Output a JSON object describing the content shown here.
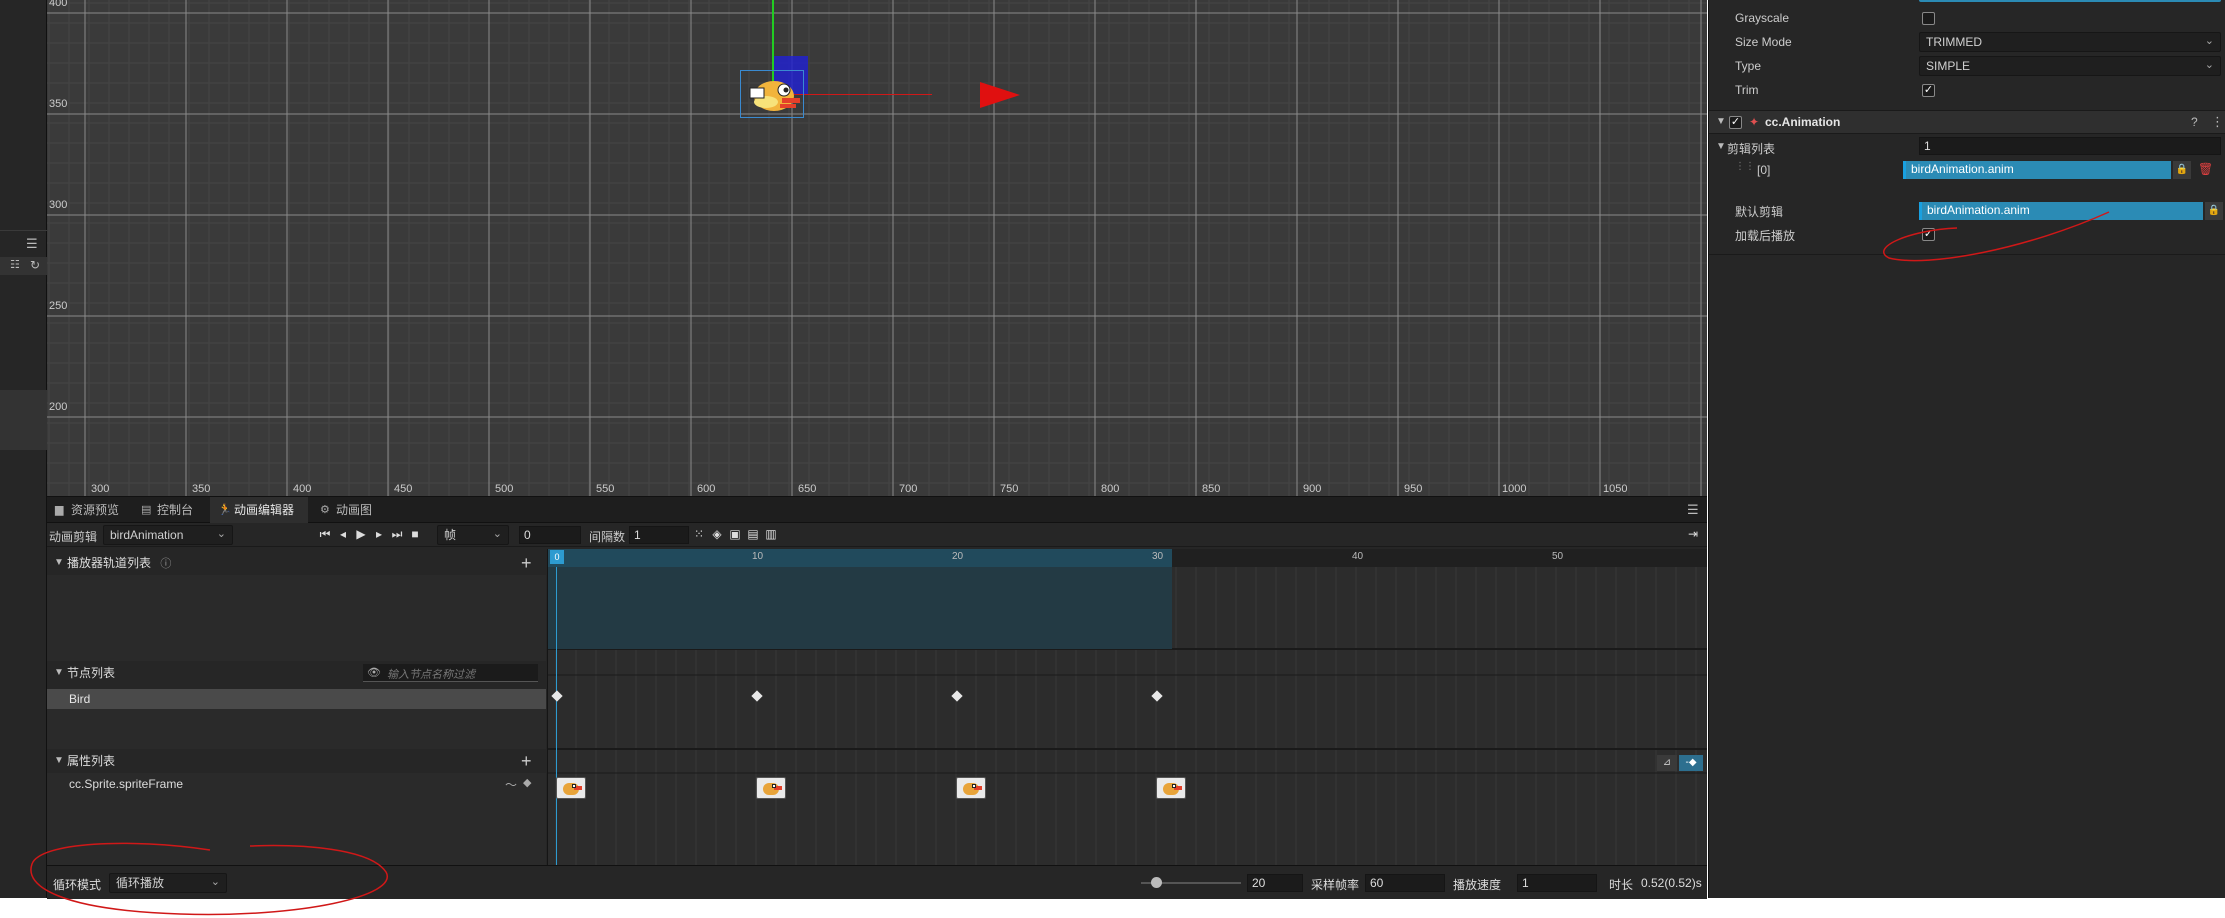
{
  "scene": {
    "y_labels": [
      "400",
      "350",
      "300",
      "250",
      "200"
    ],
    "x_labels": [
      "300",
      "350",
      "400",
      "450",
      "500",
      "550",
      "600",
      "650",
      "700",
      "750",
      "800",
      "850",
      "900",
      "950",
      "1000",
      "1050"
    ]
  },
  "inspector": {
    "sprite": {
      "grayscale_label": "Grayscale",
      "size_mode_label": "Size Mode",
      "size_mode_value": "TRIMMED",
      "type_label": "Type",
      "type_value": "SIMPLE",
      "trim_label": "Trim",
      "trim_checked": "✓"
    },
    "animation": {
      "component_title": "cc.Animation",
      "clips_label": "剪辑列表",
      "clips_count": "1",
      "clip_index": "[0]",
      "clip_value": "birdAnimation.anim",
      "default_clip_label": "默认剪辑",
      "default_clip_value": "birdAnimation.anim",
      "play_on_load_label": "加载后播放",
      "play_on_load_checked": "✓"
    }
  },
  "tabs": [
    {
      "label": "资源预览"
    },
    {
      "label": "控制台"
    },
    {
      "label": "动画编辑器"
    },
    {
      "label": "动画图"
    }
  ],
  "toolbar": {
    "clip_label": "动画剪辑",
    "clip_value": "birdAnimation",
    "unit_value": "帧",
    "frame_value": "0",
    "spacing_label": "间隔数",
    "spacing_value": "1"
  },
  "sections": {
    "tracks_title": "播放器轨道列表",
    "nodes_title": "节点列表",
    "node_filter_placeholder": "输入节点名称过滤",
    "node_name": "Bird",
    "props_title": "属性列表",
    "prop_name": "cc.Sprite.spriteFrame"
  },
  "ruler": {
    "labels": [
      "0",
      "10",
      "20",
      "30",
      "40",
      "50"
    ]
  },
  "footer": {
    "loop_label": "循环模式",
    "loop_value": "循环播放",
    "zoom_value": "20",
    "sample_label": "采样帧率",
    "sample_value": "60",
    "speed_label": "播放速度",
    "speed_value": "1",
    "duration_label": "时长",
    "duration_value": "0.52(0.52)s"
  },
  "colors": {
    "accent": "#2b8bb5",
    "annotation": "#d01818",
    "background": "#262626"
  }
}
